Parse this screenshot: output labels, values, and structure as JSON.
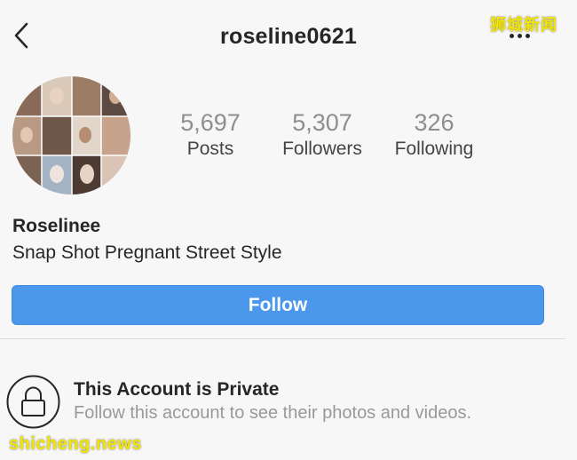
{
  "header": {
    "username": "roseline0621",
    "back_icon": "chevron-left-icon",
    "more_icon": "more-dots-icon"
  },
  "watermarks": {
    "top": "狮城新闻",
    "bottom": "shicheng.news"
  },
  "profile": {
    "avatar_icon": "profile-avatar",
    "stats": {
      "posts": {
        "value": "5,697",
        "label": "Posts"
      },
      "followers": {
        "value": "5,307",
        "label": "Followers"
      },
      "following": {
        "value": "326",
        "label": "Following"
      }
    },
    "display_name": "Roselinee",
    "bio": "Snap Shot Pregnant Street Style"
  },
  "actions": {
    "follow_label": "Follow"
  },
  "private_notice": {
    "icon": "lock-icon",
    "title": "This Account is Private",
    "subtitle": "Follow this account to see their photos and videos."
  },
  "colors": {
    "accent": "#4a97ec",
    "text": "#262626",
    "muted": "#999999",
    "watermark": "#f2e600",
    "background": "#f7f7f7"
  }
}
